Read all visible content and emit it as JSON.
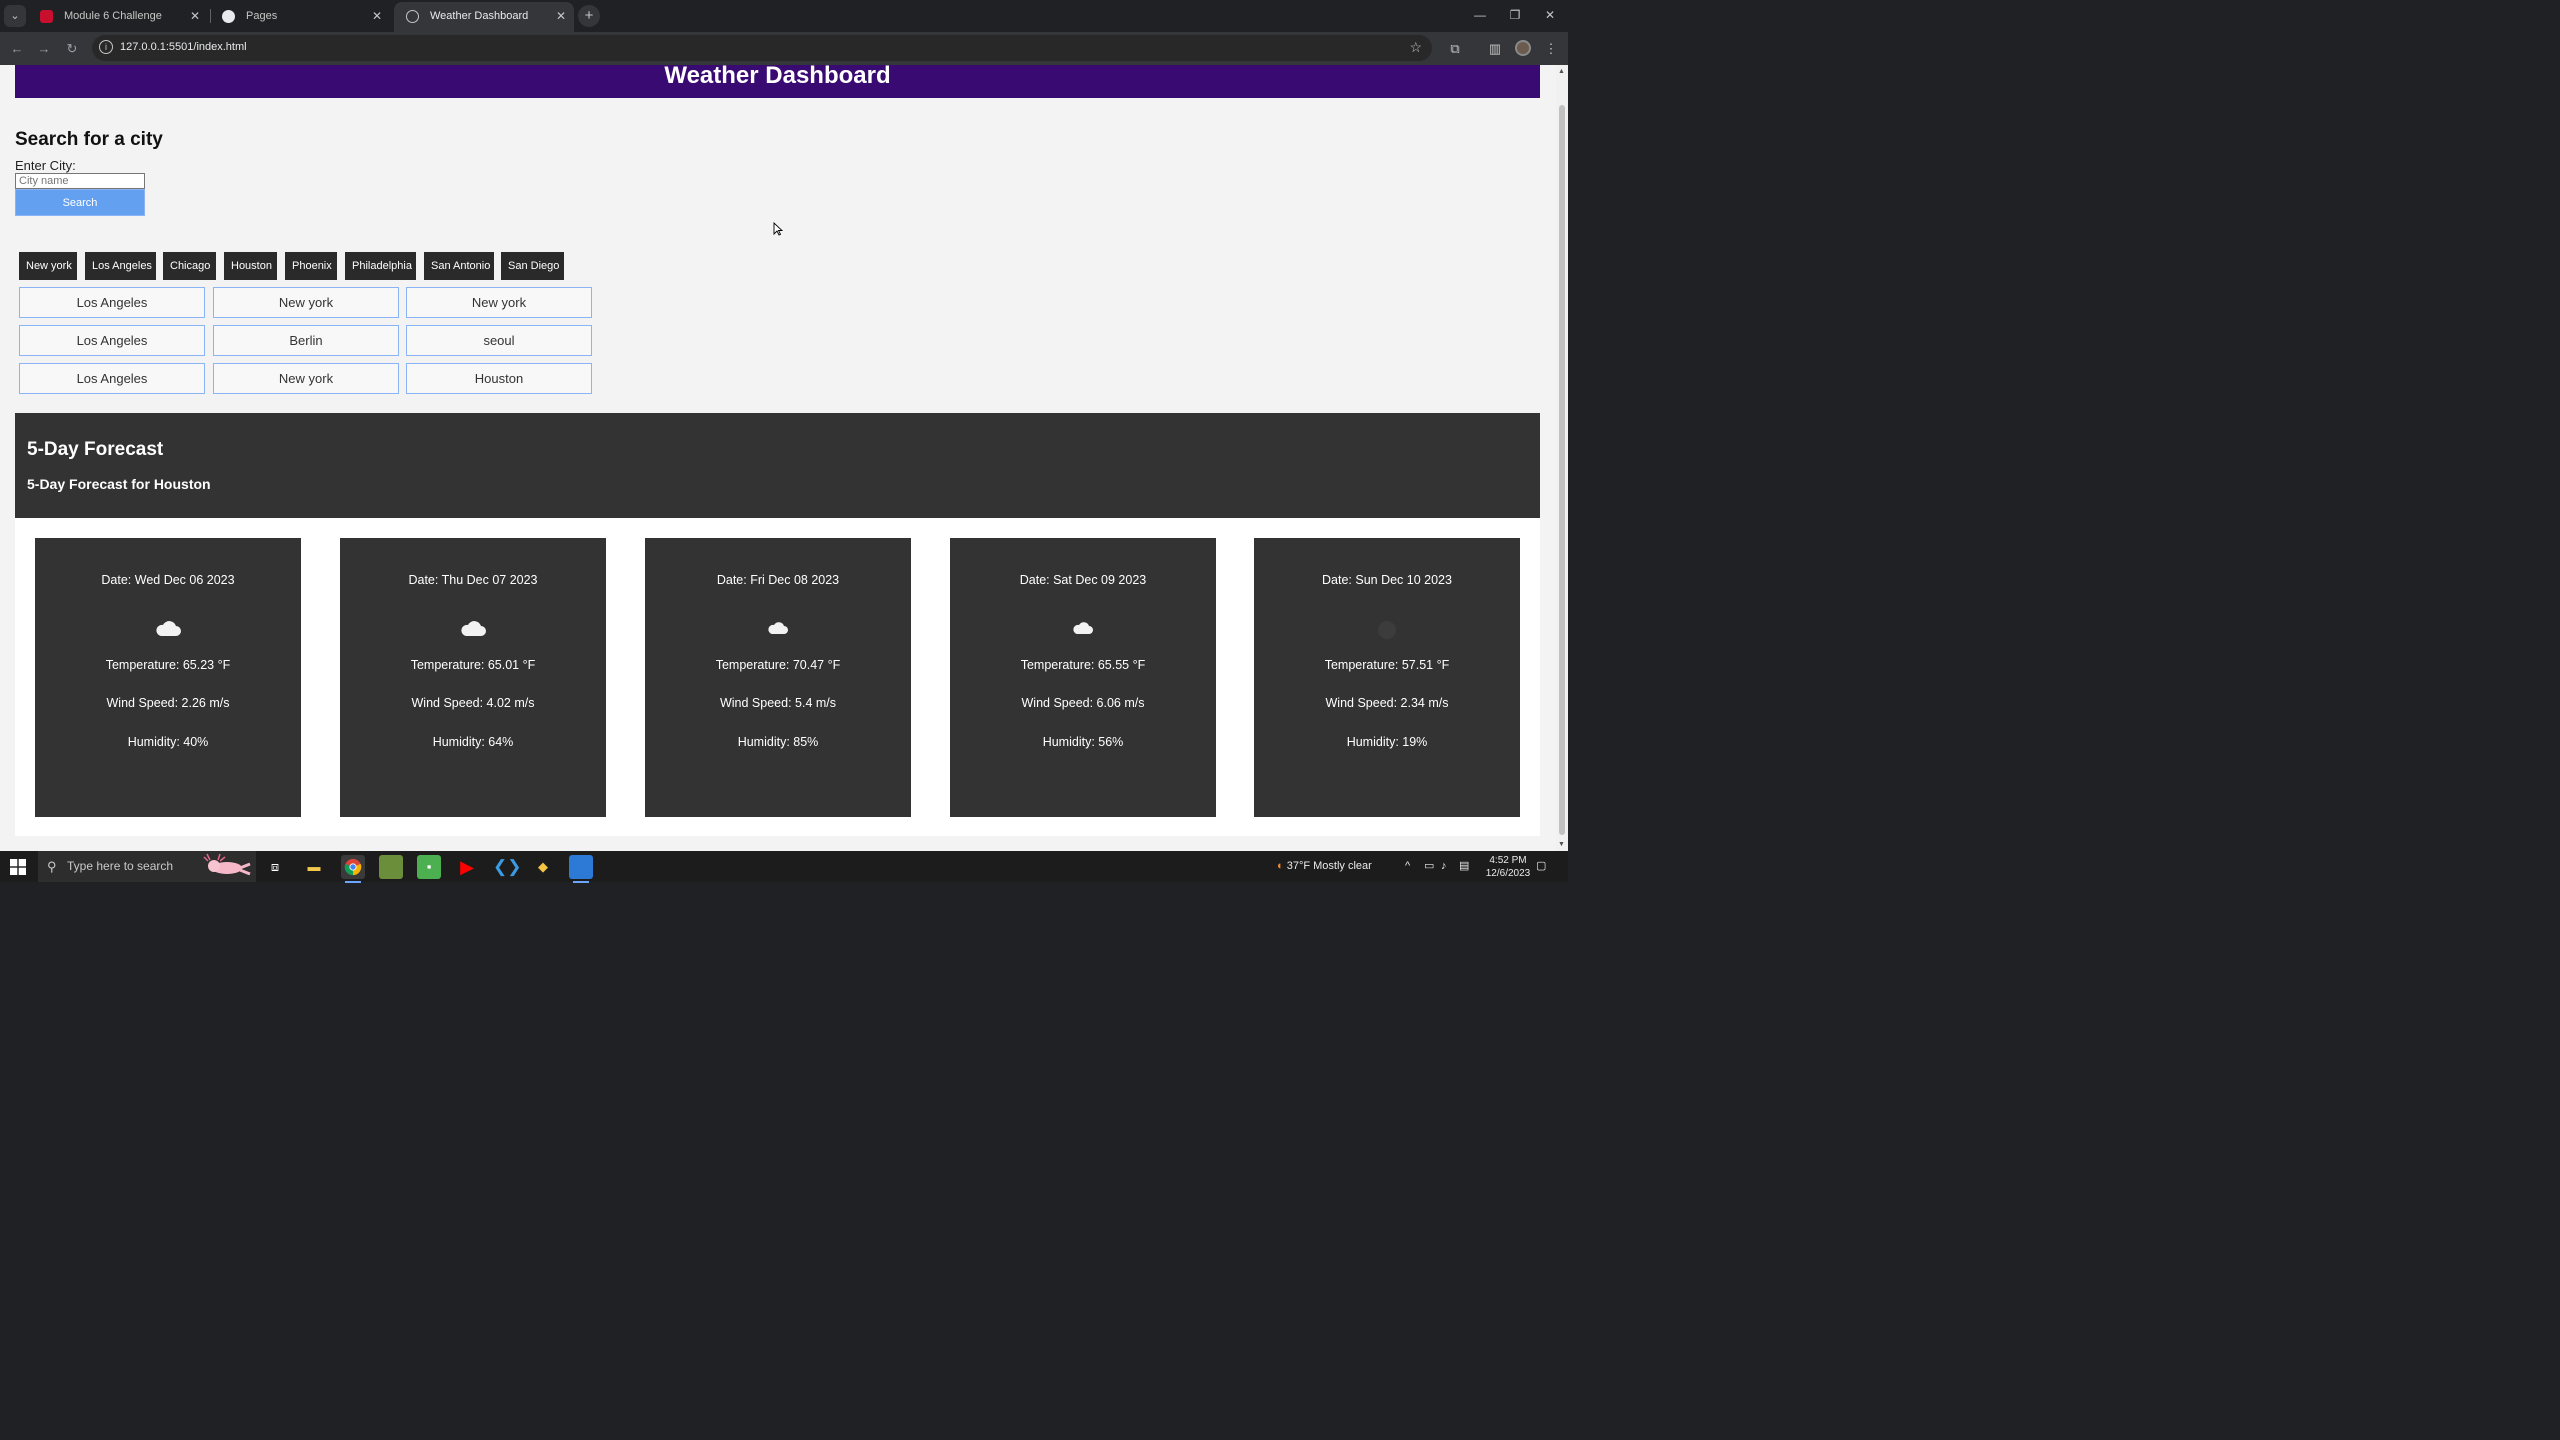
{
  "browser": {
    "tabs": [
      {
        "title": "Module 6 Challenge",
        "active": false,
        "favicon": "university-shield-icon"
      },
      {
        "title": "Pages",
        "active": false,
        "favicon": "github-icon"
      },
      {
        "title": "Weather Dashboard",
        "active": true,
        "favicon": "globe-icon"
      }
    ],
    "url": "127.0.0.1:5501/index.html"
  },
  "page": {
    "header_title": "Weather Dashboard",
    "search": {
      "title": "Search for a city",
      "label": "Enter City:",
      "placeholder": "City name",
      "value": "",
      "button_label": "Search"
    },
    "quick_cities": [
      "New york",
      "Los Angeles",
      "Chicago",
      "Houston",
      "Phoenix",
      "Philadelphia",
      "San Antonio",
      "San Diego"
    ],
    "history": [
      [
        "Los Angeles",
        "New york",
        "New york"
      ],
      [
        "Los Angeles",
        "Berlin",
        "seoul"
      ],
      [
        "Los Angeles",
        "New york",
        "Houston"
      ]
    ],
    "forecast": {
      "title": "5-Day Forecast",
      "subtitle": "5-Day Forecast for Houston",
      "days": [
        {
          "date": "Date: Wed Dec 06 2023",
          "icon": "cloud-icon",
          "temp": "Temperature: 65.23 °F",
          "wind": "Wind Speed: 2.26 m/s",
          "humidity": "Humidity: 40%"
        },
        {
          "date": "Date: Thu Dec 07 2023",
          "icon": "cloud-icon",
          "temp": "Temperature: 65.01 °F",
          "wind": "Wind Speed: 4.02 m/s",
          "humidity": "Humidity: 64%"
        },
        {
          "date": "Date: Fri Dec 08 2023",
          "icon": "cloud-icon",
          "temp": "Temperature: 70.47 °F",
          "wind": "Wind Speed: 5.4 m/s",
          "humidity": "Humidity: 85%"
        },
        {
          "date": "Date: Sat Dec 09 2023",
          "icon": "cloud-icon",
          "temp": "Temperature: 65.55 °F",
          "wind": "Wind Speed: 6.06 m/s",
          "humidity": "Humidity: 56%"
        },
        {
          "date": "Date: Sun Dec 10 2023",
          "icon": "clear-moon-icon",
          "temp": "Temperature: 57.51 °F",
          "wind": "Wind Speed: 2.34 m/s",
          "humidity": "Humidity: 19%"
        }
      ]
    }
  },
  "taskbar": {
    "search_placeholder": "Type here to search",
    "weather": "37°F  Mostly clear",
    "time": "4:52 PM",
    "date": "12/6/2023"
  },
  "colors": {
    "header_bg": "#3a0a73",
    "search_button": "#64a0f0",
    "history_border": "#8ab4f8",
    "dark_panel": "#333333"
  }
}
